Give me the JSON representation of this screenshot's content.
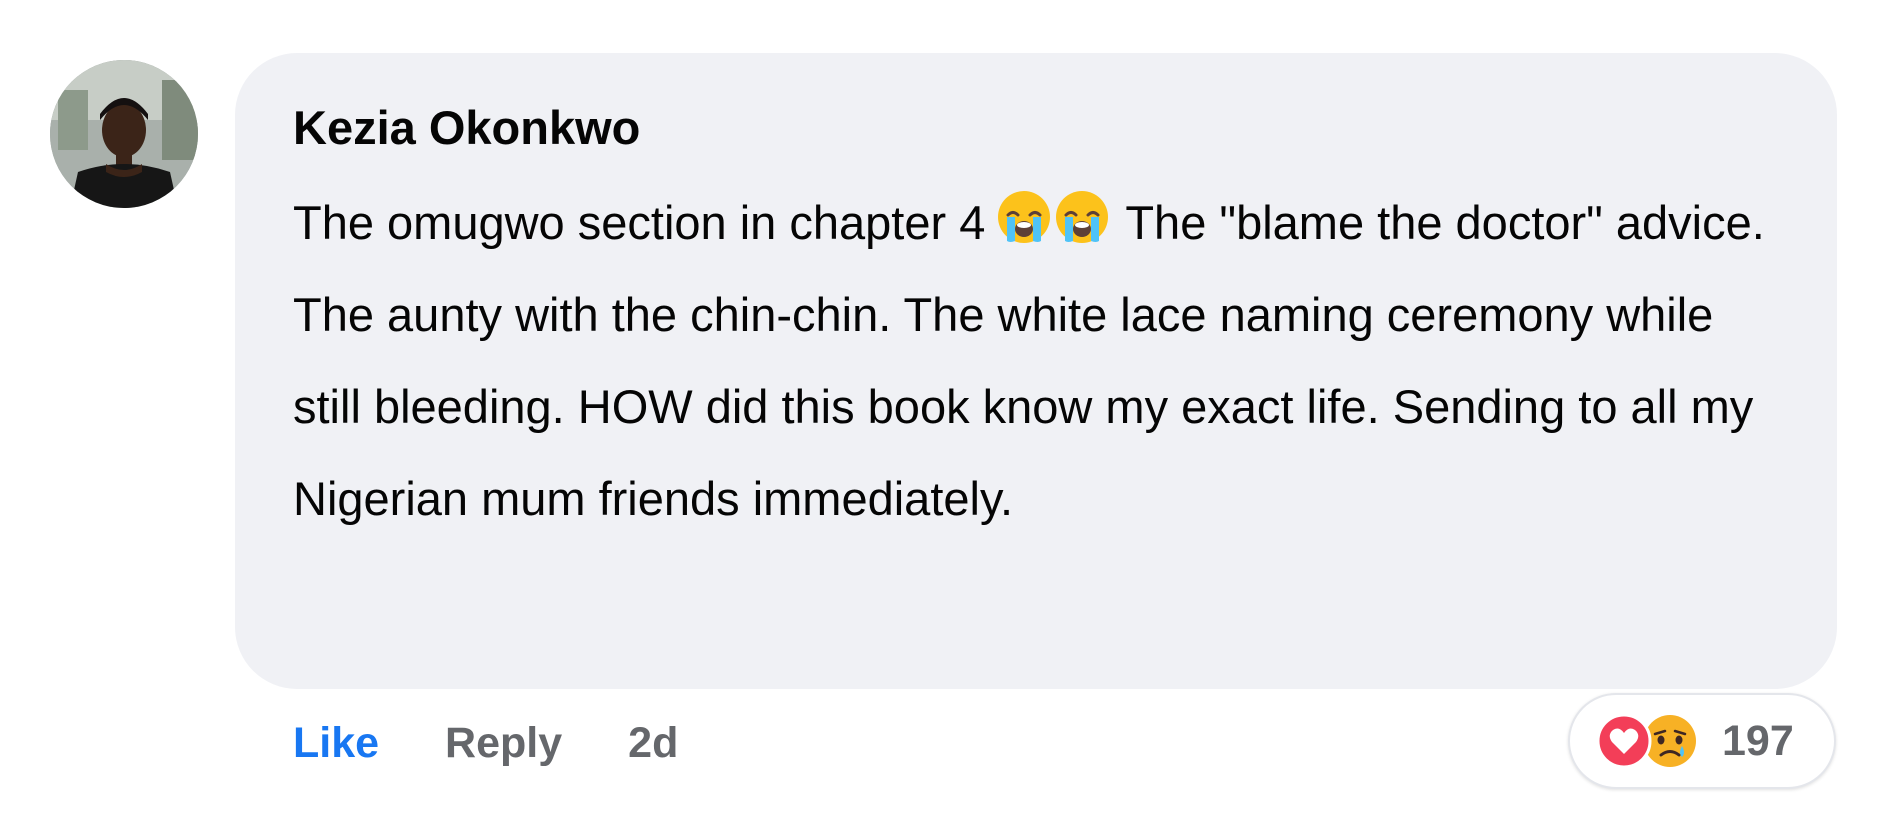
{
  "comment": {
    "author": "Kezia Okonkwo",
    "text_part1": "The  omugwo section in chapter 4",
    "emojis": [
      "loudly-crying-face",
      "loudly-crying-face"
    ],
    "text_part2": "The \"blame the doctor\" advice. The aunty with the chin-chin. The white lace naming ceremony while still bleeding. HOW did this book know my exact life. Sending to all my Nigerian mum friends immediately."
  },
  "actions": {
    "like_label": "Like",
    "reply_label": "Reply",
    "timestamp": "2d"
  },
  "reactions": {
    "icons": [
      "love-reaction",
      "sad-reaction"
    ],
    "count": "197"
  },
  "colors": {
    "bubble_bg": "#f0f1f5",
    "like_blue": "#1877f2",
    "meta_gray": "#65676b",
    "love_red": "#f33e58",
    "sad_yellow": "#f7b125"
  }
}
